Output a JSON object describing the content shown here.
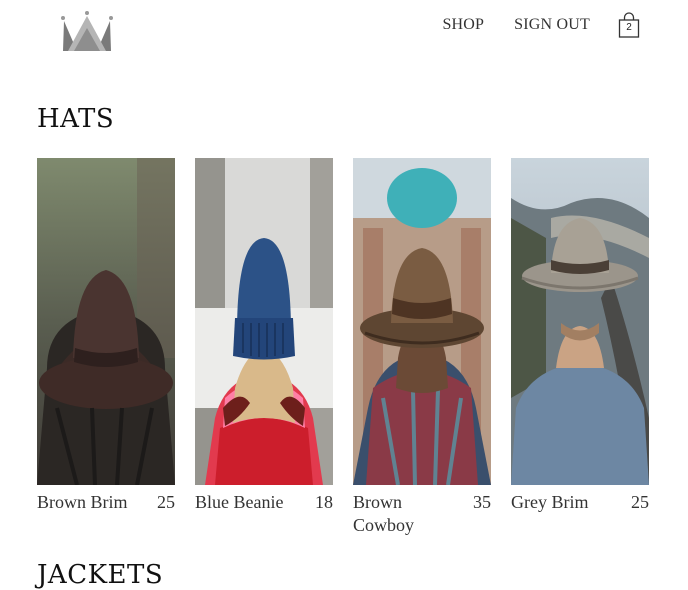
{
  "nav": {
    "shop_label": "SHOP",
    "signout_label": "SIGN OUT",
    "cart_count": "2"
  },
  "sections": [
    {
      "title": "HATS",
      "items": [
        {
          "name": "Brown Brim",
          "price": "25"
        },
        {
          "name": "Blue Beanie",
          "price": "18"
        },
        {
          "name": "Brown Cowboy",
          "price": "35"
        },
        {
          "name": "Grey Brim",
          "price": "25"
        }
      ]
    },
    {
      "title": "JACKETS"
    }
  ],
  "icons": {
    "logo": "crown-icon",
    "cart": "shopping-bag-icon"
  }
}
